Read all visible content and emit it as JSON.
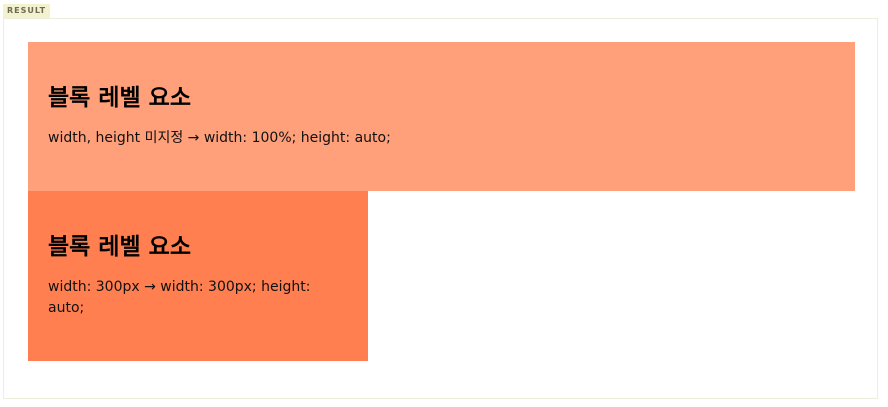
{
  "result_tab": {
    "label": "RESULT"
  },
  "colors": {
    "block_1_bg": "#ffa07a",
    "block_2_bg": "#ff7f50"
  },
  "blocks": [
    {
      "title": "블록 레벨 요소",
      "description": "width, height 미지정 → width: 100%; height: auto;"
    },
    {
      "title": "블록 레벨 요소",
      "description": "width: 300px → width: 300px; height: auto;"
    }
  ]
}
